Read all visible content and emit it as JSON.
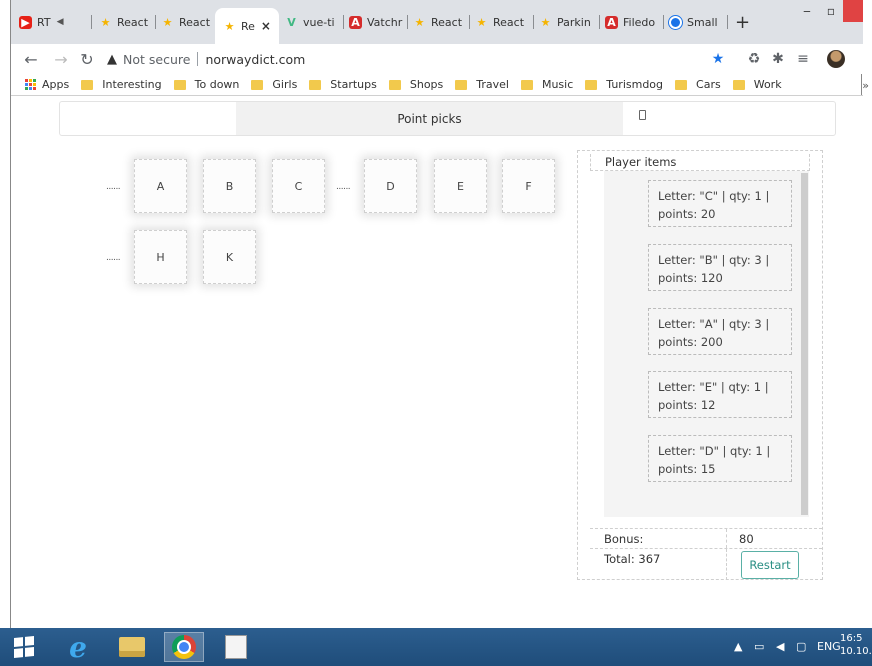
{
  "browser": {
    "tabs": [
      {
        "label": "RT",
        "icon": "youtube-icon",
        "extra": "◀"
      },
      {
        "label": "React",
        "icon": "star-icon"
      },
      {
        "label": "React",
        "icon": "star-icon"
      },
      {
        "label": "Re",
        "icon": "star-icon",
        "active": true,
        "close": "×"
      },
      {
        "label": "vue-ti",
        "icon": "vue-icon"
      },
      {
        "label": "Vatchr",
        "icon": "angular-icon"
      },
      {
        "label": "React",
        "icon": "star-icon"
      },
      {
        "label": "React",
        "icon": "star-icon"
      },
      {
        "label": "Parkin",
        "icon": "star-icon"
      },
      {
        "label": "Filedo",
        "icon": "angular-icon"
      },
      {
        "label": "Small",
        "icon": "smallpdf-icon"
      }
    ],
    "new_tab": "+",
    "url": {
      "security": "Not secure",
      "domain": "norwaydict.com"
    },
    "bookmarks": [
      "Apps",
      "Interesting",
      "To down",
      "Girls",
      "Startups",
      "Shops",
      "Travel",
      "Music",
      "Turismdog",
      "Cars",
      "Work"
    ],
    "bookmarks_more": "»"
  },
  "page": {
    "nav": {
      "active_tab": "Point picks"
    },
    "rows": [
      {
        "dots": [
          "......",
          "......"
        ],
        "cards": [
          "A",
          "B",
          "C",
          "D",
          "E",
          "F"
        ]
      },
      {
        "dots": [
          "......"
        ],
        "cards": [
          "H",
          "K"
        ]
      }
    ],
    "panel": {
      "title": "Player items",
      "items": [
        {
          "line1": "Letter: \"C\" | qty: 1 |",
          "line2": "points: 20"
        },
        {
          "line1": "Letter: \"B\" | qty: 3 |",
          "line2": "points: 120"
        },
        {
          "line1": "Letter: \"A\" | qty: 3 |",
          "line2": "points: 200"
        },
        {
          "line1": "Letter: \"E\" | qty: 1 |",
          "line2": "points: 12"
        },
        {
          "line1": "Letter: \"D\" | qty: 1 |",
          "line2": "points: 15"
        }
      ],
      "bonus_label": "Bonus:",
      "bonus_value": "80",
      "total_label": "Total: 367",
      "restart_label": "Restart"
    }
  },
  "taskbar": {
    "tray_lang": "ENG",
    "clock_time": "16:5",
    "clock_date": "10.10.2"
  },
  "colors": {
    "accent": "#2a8f84",
    "tab_strip": "#dee1e6",
    "taskbar": "#1f4d7a"
  }
}
